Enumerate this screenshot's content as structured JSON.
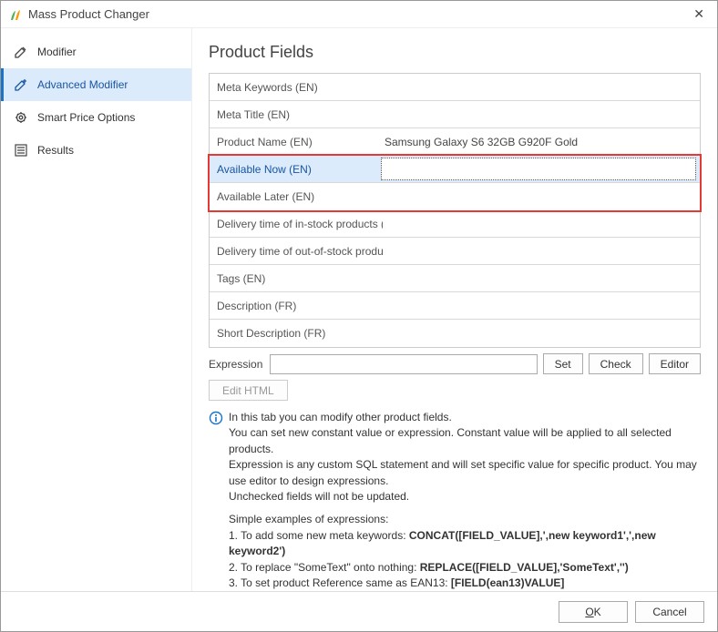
{
  "window": {
    "title": "Mass Product Changer",
    "close": "✕"
  },
  "sidebar": {
    "items": [
      {
        "label": "Modifier"
      },
      {
        "label": "Advanced Modifier"
      },
      {
        "label": "Smart Price Options"
      },
      {
        "label": "Results"
      }
    ]
  },
  "main": {
    "heading": "Product Fields",
    "fields": [
      {
        "label": "Meta Keywords (EN)",
        "value": ""
      },
      {
        "label": "Meta Title (EN)",
        "value": ""
      },
      {
        "label": "Product Name (EN)",
        "value": "Samsung Galaxy S6 32GB G920F Gold"
      },
      {
        "label": "Available Now (EN)",
        "value": ""
      },
      {
        "label": "Available Later (EN)",
        "value": ""
      },
      {
        "label": "Delivery time of in-stock products (E",
        "value": ""
      },
      {
        "label": "Delivery time of out-of-stock produ",
        "value": ""
      },
      {
        "label": "Tags (EN)",
        "value": ""
      },
      {
        "label": "Description (FR)",
        "value": ""
      },
      {
        "label": "Short Description (FR)",
        "value": ""
      }
    ],
    "expression_label": "Expression",
    "expression_value": "",
    "btn_set": "Set",
    "btn_check": "Check",
    "btn_editor": "Editor",
    "btn_edit_html": "Edit HTML",
    "info_line1": "In this tab you can modify other product fields.",
    "info_line2": "You can set new constant value or expression. Constant value will be applied to all selected products.",
    "info_line3": "Expression is any custom SQL statement and will set specific value for specific product. You may use editor to design expressions.",
    "info_line4": "Unchecked fields will not be updated.",
    "info_ex_head": "Simple examples of expressions:",
    "info_ex1_a": "1. To add some new meta keywords: ",
    "info_ex1_b": "CONCAT([FIELD_VALUE],',new keyword1',',new keyword2')",
    "info_ex2_a": "2. To replace \"SomeText\" onto nothing: ",
    "info_ex2_b": "REPLACE([FIELD_VALUE],'SomeText','')",
    "info_ex3_a": "3. To set product Reference same as EAN13: ",
    "info_ex3_b": "[FIELD(ean13)VALUE]"
  },
  "footer": {
    "ok_pre": "O",
    "ok_mid": "K",
    "cancel": "Cancel"
  }
}
